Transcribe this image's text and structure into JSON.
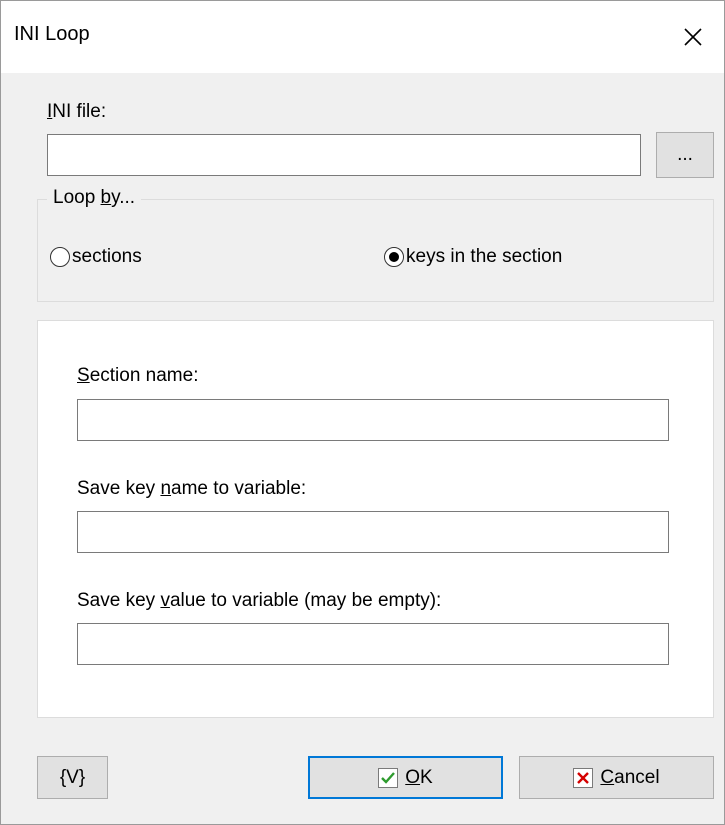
{
  "window": {
    "title": "INI Loop"
  },
  "ini_file": {
    "label_prefix": "",
    "label_underlined": "I",
    "label_rest": "NI file:",
    "value": "",
    "browse_label": "..."
  },
  "loop_by": {
    "legend_prefix": "Loop ",
    "legend_underlined": "b",
    "legend_rest": "y...",
    "options": [
      {
        "label": "sections",
        "selected": false
      },
      {
        "label": "keys in the section",
        "selected": true
      }
    ]
  },
  "section_name": {
    "label_underlined": "S",
    "label_rest": "ection name:",
    "value": ""
  },
  "key_name": {
    "label_prefix": "Save key ",
    "label_underlined": "n",
    "label_rest": "ame to variable:",
    "value": ""
  },
  "key_value": {
    "label_prefix": "Save key ",
    "label_underlined": "v",
    "label_rest": "alue to variable (may be empty):",
    "value": ""
  },
  "buttons": {
    "variables_label": "{V}",
    "ok_underlined": "O",
    "ok_rest": "K",
    "cancel_underlined": "C",
    "cancel_rest": "ancel"
  },
  "colors": {
    "window_bg": "#f0f0f0",
    "accent": "#0078d7",
    "ok_check": "#2e9b2e",
    "cancel_x": "#d40000"
  }
}
